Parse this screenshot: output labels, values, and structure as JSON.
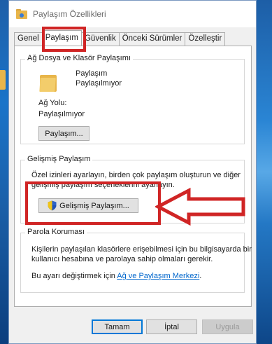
{
  "window": {
    "title": "Paylaşım Özellikleri"
  },
  "tabs": [
    {
      "label": "Genel",
      "active": false
    },
    {
      "label": "Paylaşım",
      "active": true
    },
    {
      "label": "Güvenlik",
      "active": false
    },
    {
      "label": "Önceki Sürümler",
      "active": false
    },
    {
      "label": "Özelleştir",
      "active": false
    }
  ],
  "network_share": {
    "group_title": "Ağ Dosya ve Klasör Paylaşımı",
    "folder_name": "Paylaşım",
    "folder_status": "Paylaşılmıyor",
    "network_path_label": "Ağ Yolu:",
    "network_path_value": "Paylaşılmıyor",
    "share_button": "Paylaşım..."
  },
  "advanced_share": {
    "group_title": "Gelişmiş Paylaşım",
    "description_line1": "Özel izinleri ayarlayın, birden çok paylaşım oluşturun ve diğer",
    "description_line2": "gelişmiş paylaşım seçeneklerini ayarlayın.",
    "button": "Gelişmiş Paylaşım..."
  },
  "password_protection": {
    "group_title": "Parola Koruması",
    "line1": "Kişilerin paylaşılan klasörlere erişebilmesi için bu bilgisayarda bir",
    "line2": "kullanıcı hesabına ve parolaya sahip olmaları gerekir.",
    "change_prefix": "Bu ayarı değiştirmek için",
    "link": "Ağ ve Paylaşım Merkezi",
    "change_suffix": "."
  },
  "footer": {
    "ok": "Tamam",
    "cancel": "İptal",
    "apply": "Uygula"
  },
  "colors": {
    "highlight_red": "#d02525",
    "link_blue": "#0066cc",
    "folder_yellow": "#e8b54a"
  }
}
